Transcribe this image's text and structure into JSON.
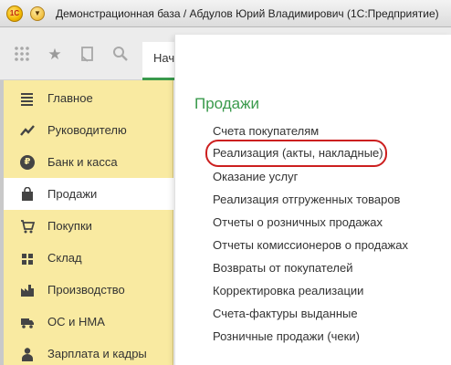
{
  "window": {
    "title": "Демонстрационная база / Абдулов Юрий Владимирович  (1С:Предприятие)",
    "logo_text": "1С"
  },
  "toolbar": {
    "start_tab_label": "Нач"
  },
  "sidebar": {
    "items": [
      {
        "label": "Главное",
        "icon": "menu-lines-icon",
        "active": false
      },
      {
        "label": "Руководителю",
        "icon": "trend-chart-icon",
        "active": false
      },
      {
        "label": "Банк и касса",
        "icon": "ruble-coin-icon",
        "active": false
      },
      {
        "label": "Продажи",
        "icon": "shopping-bag-icon",
        "active": true
      },
      {
        "label": "Покупки",
        "icon": "shopping-cart-icon",
        "active": false
      },
      {
        "label": "Склад",
        "icon": "warehouse-icon",
        "active": false
      },
      {
        "label": "Производство",
        "icon": "factory-icon",
        "active": false
      },
      {
        "label": "ОС и НМА",
        "icon": "truck-icon",
        "active": false
      },
      {
        "label": "Зарплата и кадры",
        "icon": "person-icon",
        "active": false
      }
    ]
  },
  "panel": {
    "title": "Продажи",
    "links": [
      "Счета покупателям",
      "Реализация (акты, накладные)",
      "Оказание услуг",
      "Реализация отгруженных товаров",
      "Отчеты о розничных продажах",
      "Отчеты комиссионеров о продажах",
      "Возвраты от покупателей",
      "Корректировка реализации",
      "Счета-фактуры выданные",
      "Розничные продажи (чеки)"
    ],
    "highlighted_link_index": 1
  },
  "colors": {
    "accent_green": "#3a9a4c",
    "sidebar_bg": "#f9eaa1",
    "highlight_red": "#cc1f1f"
  }
}
